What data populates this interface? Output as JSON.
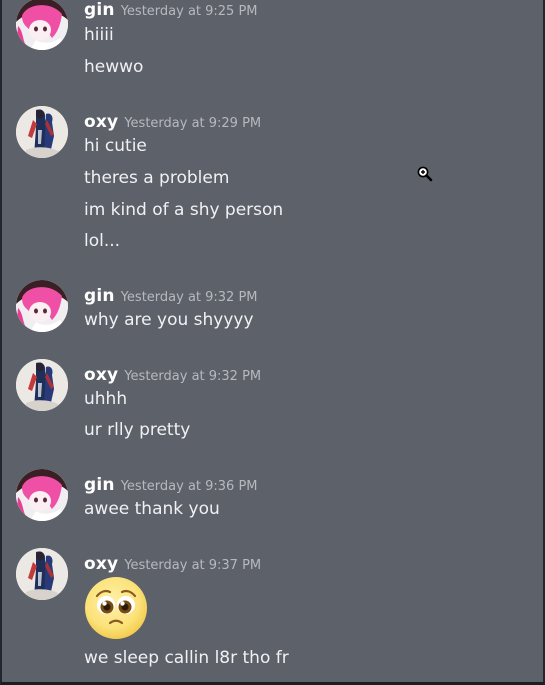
{
  "messages": [
    {
      "author": "gin",
      "timestamp": "Yesterday at 9:25 PM",
      "lines": [
        "hiiii",
        "hewwo"
      ]
    },
    {
      "author": "oxy",
      "timestamp": "Yesterday at 9:29 PM",
      "lines": [
        "hi cutie",
        "theres a problem",
        "im kind of a shy person",
        "lol..."
      ]
    },
    {
      "author": "gin",
      "timestamp": "Yesterday at 9:32 PM",
      "lines": [
        "why are you shyyyy"
      ]
    },
    {
      "author": "oxy",
      "timestamp": "Yesterday at 9:32 PM",
      "lines": [
        "uhhh",
        "ur rlly pretty"
      ]
    },
    {
      "author": "gin",
      "timestamp": "Yesterday at 9:36 PM",
      "lines": [
        "awee thank you"
      ]
    },
    {
      "author": "oxy",
      "timestamp": "Yesterday at 9:37 PM",
      "emoji": "pleading-face-emoji",
      "lines": [
        "we sleep callin l8r tho fr"
      ]
    }
  ],
  "colors": {
    "background": "#5d6169",
    "username": "#ffffff",
    "timestamp": "#b6b9be",
    "message_text": "#f0f1f3",
    "emoji_face": "#fbe27a"
  },
  "icons": {
    "cursor": "zoom-in-cursor-icon"
  }
}
